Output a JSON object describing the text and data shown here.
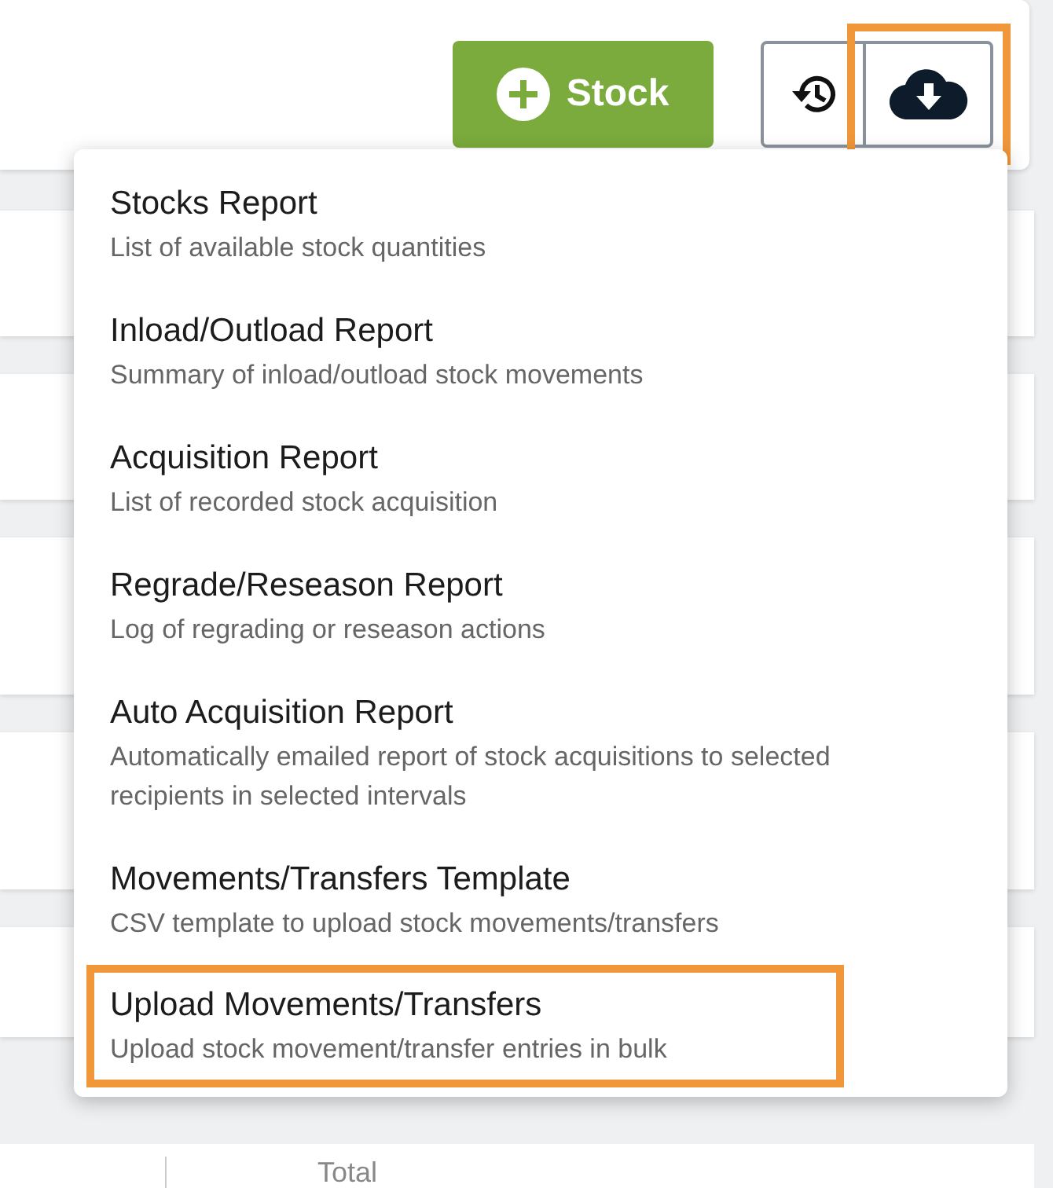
{
  "toolbar": {
    "buttons": [
      {
        "kind": "add",
        "label": "Stock",
        "highlighted": false
      },
      {
        "kind": "history",
        "highlighted": false
      },
      {
        "kind": "download",
        "highlighted": true
      }
    ]
  },
  "menu": {
    "items": [
      {
        "title": "Stocks Report",
        "description": "List of available stock quantities",
        "highlighted": false
      },
      {
        "title": "Inload/Outload Report",
        "description": "Summary of inload/outload stock movements",
        "highlighted": false
      },
      {
        "title": "Acquisition Report",
        "description": "List of recorded stock acquisition",
        "highlighted": false
      },
      {
        "title": "Regrade/Reseason Report",
        "description": "Log of regrading or reseason actions",
        "highlighted": false
      },
      {
        "title": "Auto Acquisition Report",
        "description": "Automatically emailed report of stock acquisitions to selected recipients in selected intervals",
        "highlighted": false
      },
      {
        "title": "Movements/Transfers Template",
        "description": "CSV template to upload stock movements/transfers",
        "highlighted": false
      },
      {
        "title": "Upload Movements/Transfers",
        "description": "Upload stock movement/transfer entries in bulk",
        "highlighted": true
      }
    ]
  },
  "table": {
    "footer_label": "Total"
  }
}
